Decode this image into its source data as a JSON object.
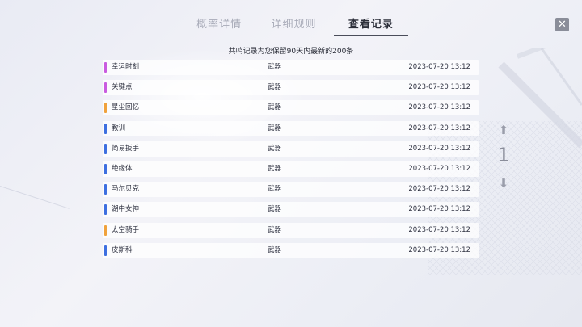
{
  "tabs": [
    {
      "label": "概率详情",
      "active": false
    },
    {
      "label": "详细规则",
      "active": false
    },
    {
      "label": "查看记录",
      "active": true
    }
  ],
  "close_icon": "close-icon",
  "notice": "共鸣记录为您保留90天内最新的200条",
  "records": [
    {
      "name": "幸运时刻",
      "type": "武器",
      "time": "2023-07-20  13:12",
      "rarity_color": "#c95be0"
    },
    {
      "name": "关键点",
      "type": "武器",
      "time": "2023-07-20  13:12",
      "rarity_color": "#c95be0"
    },
    {
      "name": "星尘回忆",
      "type": "武器",
      "time": "2023-07-20  13:12",
      "rarity_color": "#f0a23c"
    },
    {
      "name": "教训",
      "type": "武器",
      "time": "2023-07-20  13:12",
      "rarity_color": "#3d6fe0"
    },
    {
      "name": "简易扳手",
      "type": "武器",
      "time": "2023-07-20  13:12",
      "rarity_color": "#3d6fe0"
    },
    {
      "name": "绝缘体",
      "type": "武器",
      "time": "2023-07-20  13:12",
      "rarity_color": "#3d6fe0"
    },
    {
      "name": "马尔贝克",
      "type": "武器",
      "time": "2023-07-20  13:12",
      "rarity_color": "#3d6fe0"
    },
    {
      "name": "湖中女神",
      "type": "武器",
      "time": "2023-07-20  13:12",
      "rarity_color": "#3d6fe0"
    },
    {
      "name": "太空骑手",
      "type": "武器",
      "time": "2023-07-20  13:12",
      "rarity_color": "#f0a23c"
    },
    {
      "name": "皮斯科",
      "type": "武器",
      "time": "2023-07-20  13:12",
      "rarity_color": "#3d6fe0"
    }
  ],
  "pager": {
    "page": "1",
    "up_icon": "arrow-up-icon",
    "down_icon": "arrow-down-icon"
  }
}
